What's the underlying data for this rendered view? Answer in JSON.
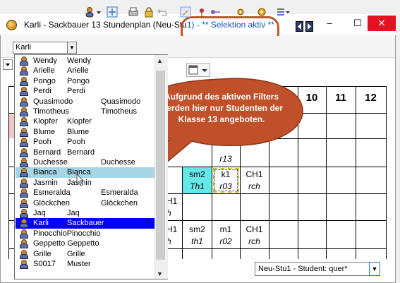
{
  "window": {
    "title_prefix": "Karli - Sackbauer 13  Stundenplan  (Neu-Stu",
    "title_suffix": "1) - ** Selektion aktiv **",
    "minimize": "–",
    "maximize": "☐",
    "close": "✕"
  },
  "toolbar": {
    "student_combo_value": "Karli"
  },
  "timetable": {
    "period_headers": [
      "10",
      "11",
      "12"
    ],
    "lessons": [
      {
        "subject": "r13",
        "room": ""
      },
      {
        "subject": "sm2",
        "room": "Th1"
      },
      {
        "subject": "k1",
        "room": "r03"
      },
      {
        "subject": "CH1",
        "room": "rch"
      },
      {
        "subject": "H1",
        "room": "h"
      },
      {
        "subject": "H1",
        "room": "h"
      },
      {
        "subject": "sm2",
        "room": "th1"
      },
      {
        "subject": "m1",
        "room": "r02"
      },
      {
        "subject": "CH1",
        "room": "rch"
      }
    ]
  },
  "dropdown": {
    "items": [
      {
        "c1": "Wendy",
        "c2": "Wendy",
        "c3": ""
      },
      {
        "c1": "Arielle",
        "c2": "Arielle",
        "c3": ""
      },
      {
        "c1": "Pongo",
        "c2": "Pongo",
        "c3": ""
      },
      {
        "c1": "Perdi",
        "c2": "Perdi",
        "c3": ""
      },
      {
        "c1": "Quasimodo",
        "c2": "",
        "c3": "Quasimodo"
      },
      {
        "c1": "Timotheus",
        "c2": "",
        "c3": "Timotheus"
      },
      {
        "c1": "Klopfer",
        "c2": "Klopfer",
        "c3": ""
      },
      {
        "c1": "Blume",
        "c2": "Blume",
        "c3": ""
      },
      {
        "c1": "Pooh",
        "c2": "Pooh",
        "c3": ""
      },
      {
        "c1": "Bernard",
        "c2": "Bernard",
        "c3": ""
      },
      {
        "c1": "Duchesse",
        "c2": "",
        "c3": "Duchesse"
      },
      {
        "c1": "Bianca",
        "c2": "Bianca",
        "c3": ""
      },
      {
        "c1": "Jasmin",
        "c2": "Jasmin",
        "c3": ""
      },
      {
        "c1": "Esmeralda",
        "c2": "",
        "c3": "Esmeralda"
      },
      {
        "c1": "Glöckchen",
        "c2": "",
        "c3": "Glöckchen"
      },
      {
        "c1": "Jaq",
        "c2": "Jaq",
        "c3": ""
      },
      {
        "c1": "Karli",
        "c2": "Sackbauer",
        "c3": ""
      },
      {
        "c1": "PinocchioPinocchio",
        "c2": "",
        "c3": ""
      },
      {
        "c1": "Geppetto Geppetto",
        "c2": "",
        "c3": ""
      },
      {
        "c1": "Grille",
        "c2": "Grille",
        "c3": ""
      },
      {
        "c1": "S0017",
        "c2": "Muster",
        "c3": ""
      }
    ],
    "hover_index": 11,
    "selected_index": 16
  },
  "callout": {
    "text": "Aufgrund des aktiven Filters werden hier nur Studenten der Klasse 13 angeboten."
  },
  "view_select": {
    "value": "Neu-Stu1 - Student: quer*"
  },
  "colors": {
    "highlight_ring": "#c0562c",
    "callout_fill": "#c0502a",
    "hover_row": "#a6d6e6",
    "selected_row": "#0000ff",
    "lesson_cyan": "#66e8e8",
    "title_highlight": "#1a4fb5"
  }
}
